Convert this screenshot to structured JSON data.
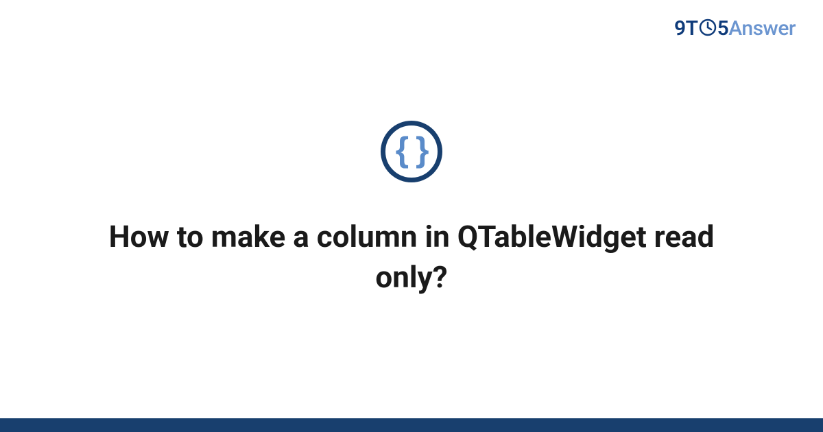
{
  "site": {
    "logo": {
      "prefix": "9T",
      "suffix": "5",
      "brand_word": "Answer"
    }
  },
  "category_icon": {
    "glyph": "{ }",
    "semantic": "code-braces-icon"
  },
  "main": {
    "title": "How to make a column in QTableWidget read only?"
  },
  "colors": {
    "brand_dark": "#183f6e",
    "brand_light": "#6b95d0",
    "icon_inner": "#5a8bc9"
  }
}
